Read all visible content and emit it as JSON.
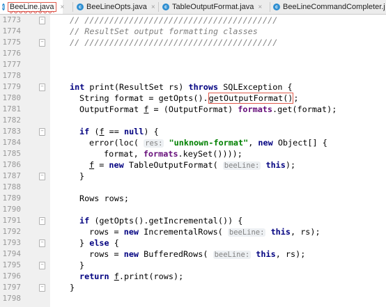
{
  "tabs": [
    {
      "label": "BeeLine.java",
      "close": "×",
      "active": true
    },
    {
      "label": "BeeLineOpts.java",
      "close": "×",
      "active": false
    },
    {
      "label": "TableOutputFormat.java",
      "close": "×",
      "active": false
    },
    {
      "label": "BeeLineCommandCompleter.j",
      "close": "",
      "active": false
    }
  ],
  "tab_icon_letter": "c",
  "line_numbers": [
    "1773",
    "1774",
    "1775",
    "1776",
    "1777",
    "1778",
    "1779",
    "1780",
    "1781",
    "1782",
    "1783",
    "1784",
    "1785",
    "1786",
    "1787",
    "1788",
    "1789",
    "1790",
    "1791",
    "1792",
    "1793",
    "1794",
    "1795",
    "1796",
    "1797",
    "1798"
  ],
  "code": {
    "comment1": "// ///////////////////////////////////////",
    "comment2": "// ResultSet output formatting classes",
    "comment3": "// ///////////////////////////////////////",
    "l1779_kw1": "int",
    "l1779_a": " print(ResultSet rs) ",
    "l1779_kw2": "throws",
    "l1779_b": " SQLException {",
    "l1780_a": "String format = getOpts().",
    "l1780_boxed": "getOutputFormat()",
    "l1780_b": ";",
    "l1781_a": "OutputFormat ",
    "l1781_f": "f",
    "l1781_b": " = (OutputFormat) ",
    "l1781_fld": "formats",
    "l1781_c": ".get(format);",
    "l1783_kw": "if",
    "l1783_a": " (",
    "l1783_f": "f",
    "l1783_b": " == ",
    "l1783_kw2": "null",
    "l1783_c": ") {",
    "l1784_a": "error(loc( ",
    "l1784_hint": "res:",
    "l1784_sp": " ",
    "l1784_str": "\"unknown-format\"",
    "l1784_b": ", ",
    "l1784_kw": "new",
    "l1784_c": " Object[] {",
    "l1785_a": "format, ",
    "l1785_fld": "formats",
    "l1785_b": ".keySet())));",
    "l1786_f": "f",
    "l1786_a": " = ",
    "l1786_kw": "new",
    "l1786_b": " TableOutputFormat( ",
    "l1786_hint": "beeLine:",
    "l1786_sp": " ",
    "l1786_kw2": "this",
    "l1786_c": ");",
    "l1787": "}",
    "l1789": "Rows rows;",
    "l1791_kw": "if",
    "l1791_a": " (getOpts().getIncremental()) {",
    "l1792_a": "rows = ",
    "l1792_kw": "new",
    "l1792_b": " IncrementalRows( ",
    "l1792_hint": "beeLine:",
    "l1792_sp": " ",
    "l1792_kw2": "this",
    "l1792_c": ", rs);",
    "l1793_a": "} ",
    "l1793_kw": "else",
    "l1793_b": " {",
    "l1794_a": "rows = ",
    "l1794_kw": "new",
    "l1794_b": " BufferedRows( ",
    "l1794_hint": "beeLine:",
    "l1794_sp": " ",
    "l1794_kw2": "this",
    "l1794_c": ", rs);",
    "l1795": "}",
    "l1796_kw": "return",
    "l1796_a": " ",
    "l1796_f": "f",
    "l1796_b": ".print(rows);",
    "l1797": "}"
  }
}
